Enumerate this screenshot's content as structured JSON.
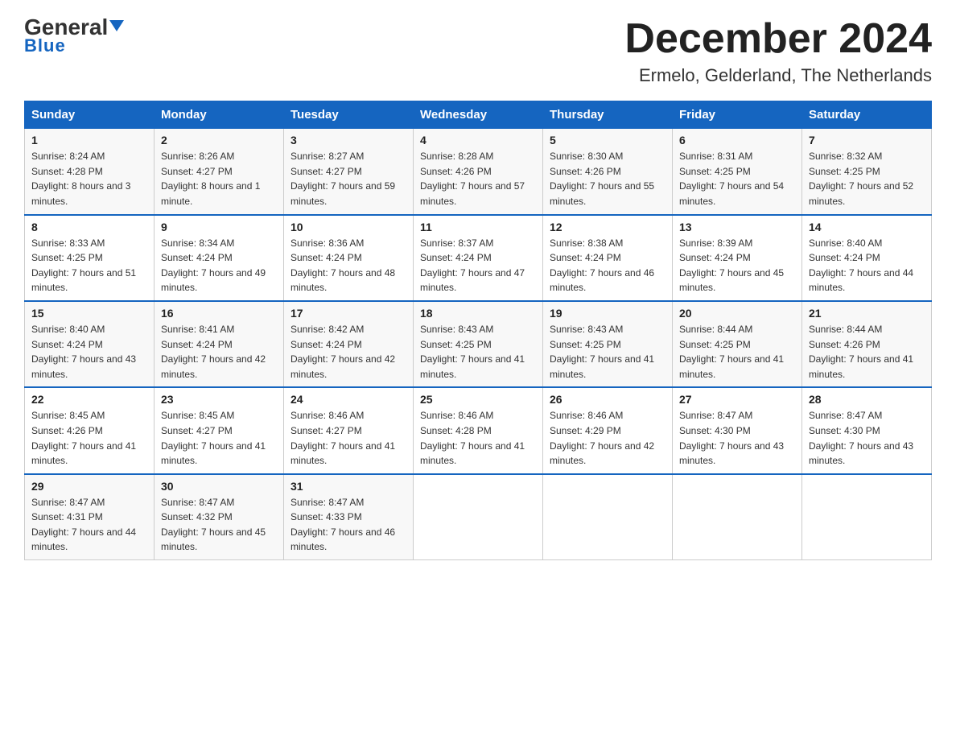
{
  "logo": {
    "general": "General",
    "blue": "Blue",
    "triangle_color": "#1565c0"
  },
  "header": {
    "month_year": "December 2024",
    "location": "Ermelo, Gelderland, The Netherlands"
  },
  "days_of_week": [
    "Sunday",
    "Monday",
    "Tuesday",
    "Wednesday",
    "Thursday",
    "Friday",
    "Saturday"
  ],
  "weeks": [
    [
      {
        "num": "1",
        "sunrise": "8:24 AM",
        "sunset": "4:28 PM",
        "daylight": "8 hours and 3 minutes."
      },
      {
        "num": "2",
        "sunrise": "8:26 AM",
        "sunset": "4:27 PM",
        "daylight": "8 hours and 1 minute."
      },
      {
        "num": "3",
        "sunrise": "8:27 AM",
        "sunset": "4:27 PM",
        "daylight": "7 hours and 59 minutes."
      },
      {
        "num": "4",
        "sunrise": "8:28 AM",
        "sunset": "4:26 PM",
        "daylight": "7 hours and 57 minutes."
      },
      {
        "num": "5",
        "sunrise": "8:30 AM",
        "sunset": "4:26 PM",
        "daylight": "7 hours and 55 minutes."
      },
      {
        "num": "6",
        "sunrise": "8:31 AM",
        "sunset": "4:25 PM",
        "daylight": "7 hours and 54 minutes."
      },
      {
        "num": "7",
        "sunrise": "8:32 AM",
        "sunset": "4:25 PM",
        "daylight": "7 hours and 52 minutes."
      }
    ],
    [
      {
        "num": "8",
        "sunrise": "8:33 AM",
        "sunset": "4:25 PM",
        "daylight": "7 hours and 51 minutes."
      },
      {
        "num": "9",
        "sunrise": "8:34 AM",
        "sunset": "4:24 PM",
        "daylight": "7 hours and 49 minutes."
      },
      {
        "num": "10",
        "sunrise": "8:36 AM",
        "sunset": "4:24 PM",
        "daylight": "7 hours and 48 minutes."
      },
      {
        "num": "11",
        "sunrise": "8:37 AM",
        "sunset": "4:24 PM",
        "daylight": "7 hours and 47 minutes."
      },
      {
        "num": "12",
        "sunrise": "8:38 AM",
        "sunset": "4:24 PM",
        "daylight": "7 hours and 46 minutes."
      },
      {
        "num": "13",
        "sunrise": "8:39 AM",
        "sunset": "4:24 PM",
        "daylight": "7 hours and 45 minutes."
      },
      {
        "num": "14",
        "sunrise": "8:40 AM",
        "sunset": "4:24 PM",
        "daylight": "7 hours and 44 minutes."
      }
    ],
    [
      {
        "num": "15",
        "sunrise": "8:40 AM",
        "sunset": "4:24 PM",
        "daylight": "7 hours and 43 minutes."
      },
      {
        "num": "16",
        "sunrise": "8:41 AM",
        "sunset": "4:24 PM",
        "daylight": "7 hours and 42 minutes."
      },
      {
        "num": "17",
        "sunrise": "8:42 AM",
        "sunset": "4:24 PM",
        "daylight": "7 hours and 42 minutes."
      },
      {
        "num": "18",
        "sunrise": "8:43 AM",
        "sunset": "4:25 PM",
        "daylight": "7 hours and 41 minutes."
      },
      {
        "num": "19",
        "sunrise": "8:43 AM",
        "sunset": "4:25 PM",
        "daylight": "7 hours and 41 minutes."
      },
      {
        "num": "20",
        "sunrise": "8:44 AM",
        "sunset": "4:25 PM",
        "daylight": "7 hours and 41 minutes."
      },
      {
        "num": "21",
        "sunrise": "8:44 AM",
        "sunset": "4:26 PM",
        "daylight": "7 hours and 41 minutes."
      }
    ],
    [
      {
        "num": "22",
        "sunrise": "8:45 AM",
        "sunset": "4:26 PM",
        "daylight": "7 hours and 41 minutes."
      },
      {
        "num": "23",
        "sunrise": "8:45 AM",
        "sunset": "4:27 PM",
        "daylight": "7 hours and 41 minutes."
      },
      {
        "num": "24",
        "sunrise": "8:46 AM",
        "sunset": "4:27 PM",
        "daylight": "7 hours and 41 minutes."
      },
      {
        "num": "25",
        "sunrise": "8:46 AM",
        "sunset": "4:28 PM",
        "daylight": "7 hours and 41 minutes."
      },
      {
        "num": "26",
        "sunrise": "8:46 AM",
        "sunset": "4:29 PM",
        "daylight": "7 hours and 42 minutes."
      },
      {
        "num": "27",
        "sunrise": "8:47 AM",
        "sunset": "4:30 PM",
        "daylight": "7 hours and 43 minutes."
      },
      {
        "num": "28",
        "sunrise": "8:47 AM",
        "sunset": "4:30 PM",
        "daylight": "7 hours and 43 minutes."
      }
    ],
    [
      {
        "num": "29",
        "sunrise": "8:47 AM",
        "sunset": "4:31 PM",
        "daylight": "7 hours and 44 minutes."
      },
      {
        "num": "30",
        "sunrise": "8:47 AM",
        "sunset": "4:32 PM",
        "daylight": "7 hours and 45 minutes."
      },
      {
        "num": "31",
        "sunrise": "8:47 AM",
        "sunset": "4:33 PM",
        "daylight": "7 hours and 46 minutes."
      },
      null,
      null,
      null,
      null
    ]
  ]
}
